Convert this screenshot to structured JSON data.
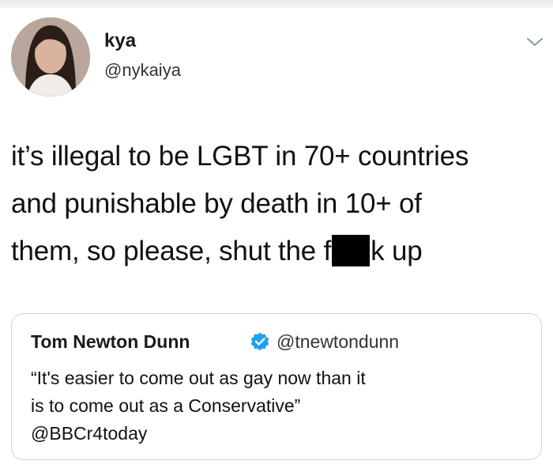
{
  "tweet": {
    "display_name": "kya",
    "handle": "@nykaiya",
    "text_lines": [
      "it’s illegal to be LGBT in 70+ countries",
      "and punishable by death in 10+ of",
      "them, so please, shut the f",
      "k up"
    ]
  },
  "quoted_tweet": {
    "display_name": "Tom Newton Dunn",
    "handle": "@tnewtondunn",
    "verified": true,
    "text_lines": [
      "“It's easier to come out as gay now than it",
      "is to come out as a Conservative”",
      "@BBCr4today"
    ]
  },
  "icons": {
    "menu": "chevron-down-icon",
    "verified": "verified-badge-icon",
    "avatar": "user-avatar"
  },
  "colors": {
    "verified_blue": "#1da1f2",
    "border": "#cfd6dc",
    "chevron": "#8899a6"
  }
}
